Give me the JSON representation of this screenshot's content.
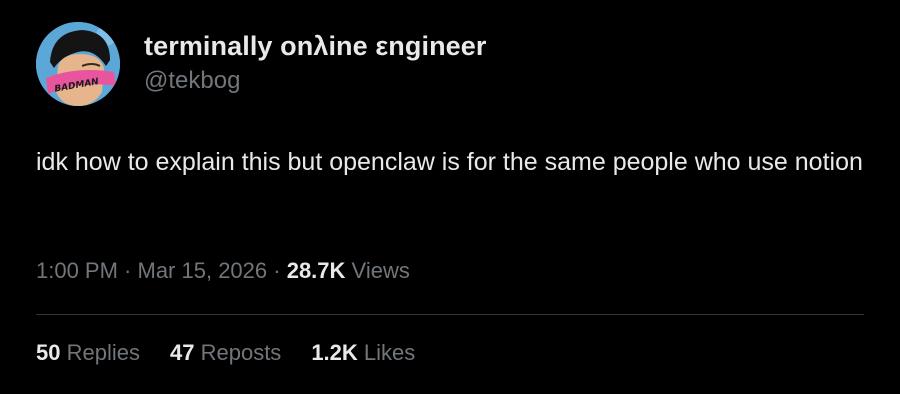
{
  "author": {
    "display_name": "terminally onλine εngineer",
    "handle": "@tekbog",
    "avatar": {
      "icon": "avatar-badman-icon",
      "headband_text": "BADMAN",
      "bg_color": "#5aa7d8",
      "headband_color": "#e8559c"
    }
  },
  "tweet": {
    "text": "idk how to explain this but openclaw is for the same people who use notion"
  },
  "meta": {
    "time": "1:00 PM",
    "separator_1": " · ",
    "date": "Mar 15, 2026",
    "separator_2": " · ",
    "views_count": "28.7K",
    "views_label": "Views"
  },
  "stats": {
    "replies_count": "50",
    "replies_label": "Replies",
    "reposts_count": "47",
    "reposts_label": "Reposts",
    "likes_count": "1.2K",
    "likes_label": "Likes"
  },
  "colors": {
    "background": "#000000",
    "primary_text": "#e7e9ea",
    "secondary_text": "#71767b",
    "divider": "#2f3336"
  }
}
